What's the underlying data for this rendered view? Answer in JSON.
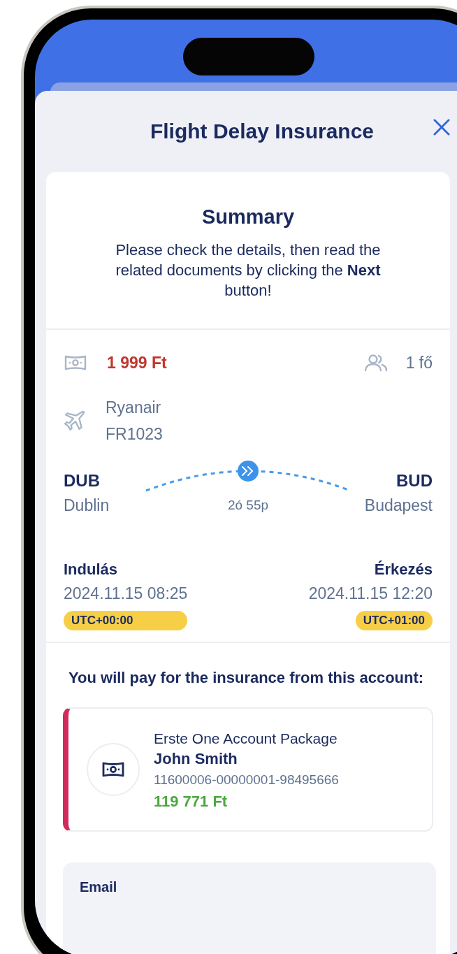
{
  "sheet": {
    "title": "Flight Delay Insurance"
  },
  "summary": {
    "title": "Summary",
    "text": "Please check the details, then read the related documents by clicking the **Next** button!"
  },
  "price": "1 999 Ft",
  "passengers": "1 fő",
  "flight": {
    "airline": "Ryanair",
    "number": "FR1023"
  },
  "route": {
    "from": {
      "code": "DUB",
      "city": "Dublin"
    },
    "to": {
      "code": "BUD",
      "city": "Budapest"
    },
    "duration": "2ó 55p"
  },
  "times": [
    {
      "label": "Indulás",
      "datetime": "2024.11.15 08:25",
      "timezone": "UTC+00:00"
    },
    {
      "label": "Érkezés",
      "datetime": "2024.11.15 12:20",
      "timezone": "UTC+01:00"
    }
  ],
  "account_section": {
    "heading": "You will pay for the insurance from this account:",
    "account": {
      "name": "Erste One Account Package",
      "holder": "John Smith",
      "number": "11600006-00000001-98495666",
      "balance": "119 771 Ft"
    }
  },
  "email": {
    "label": "Email"
  }
}
